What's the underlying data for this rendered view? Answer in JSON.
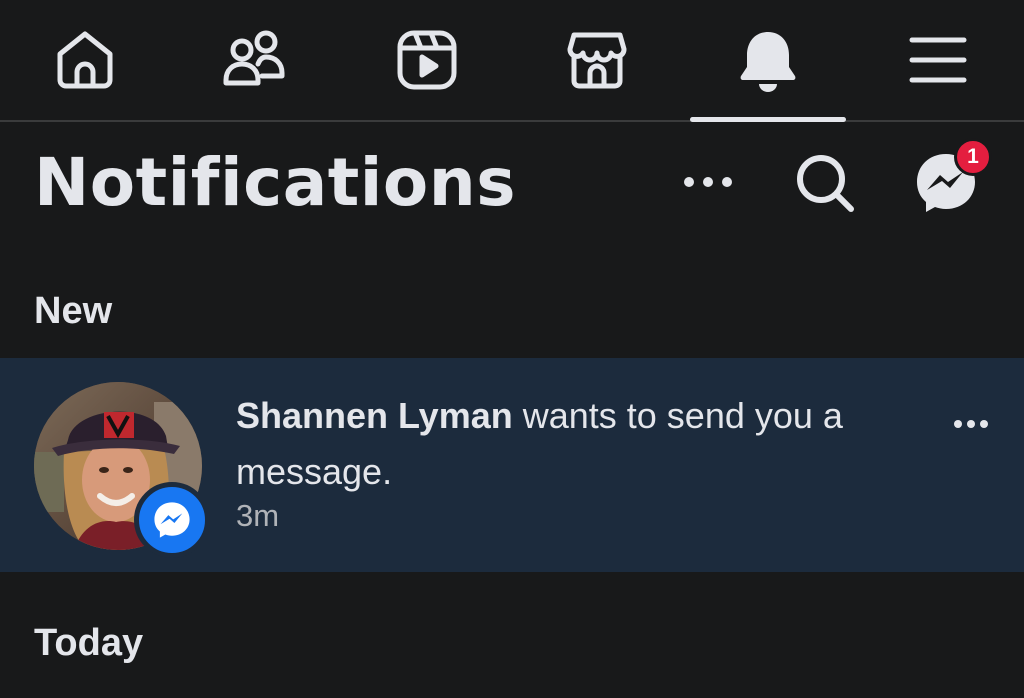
{
  "nav": {
    "tabs": [
      {
        "icon": "home-icon"
      },
      {
        "icon": "friends-icon"
      },
      {
        "icon": "video-icon"
      },
      {
        "icon": "marketplace-icon"
      },
      {
        "icon": "bell-icon",
        "active": true
      },
      {
        "icon": "menu-icon"
      }
    ]
  },
  "header": {
    "title": "Notifications",
    "messenger_badge": "1"
  },
  "sections": {
    "new_label": "New",
    "today_label": "Today"
  },
  "notification": {
    "name": "Shannen Lyman",
    "message": " wants to send you a message.",
    "time": "3m",
    "badge_icon": "messenger-icon"
  },
  "colors": {
    "background": "#18191a",
    "unread_row": "#1c2b3d",
    "badge_red": "#e41e3f",
    "messenger_blue": "#1877f2"
  }
}
